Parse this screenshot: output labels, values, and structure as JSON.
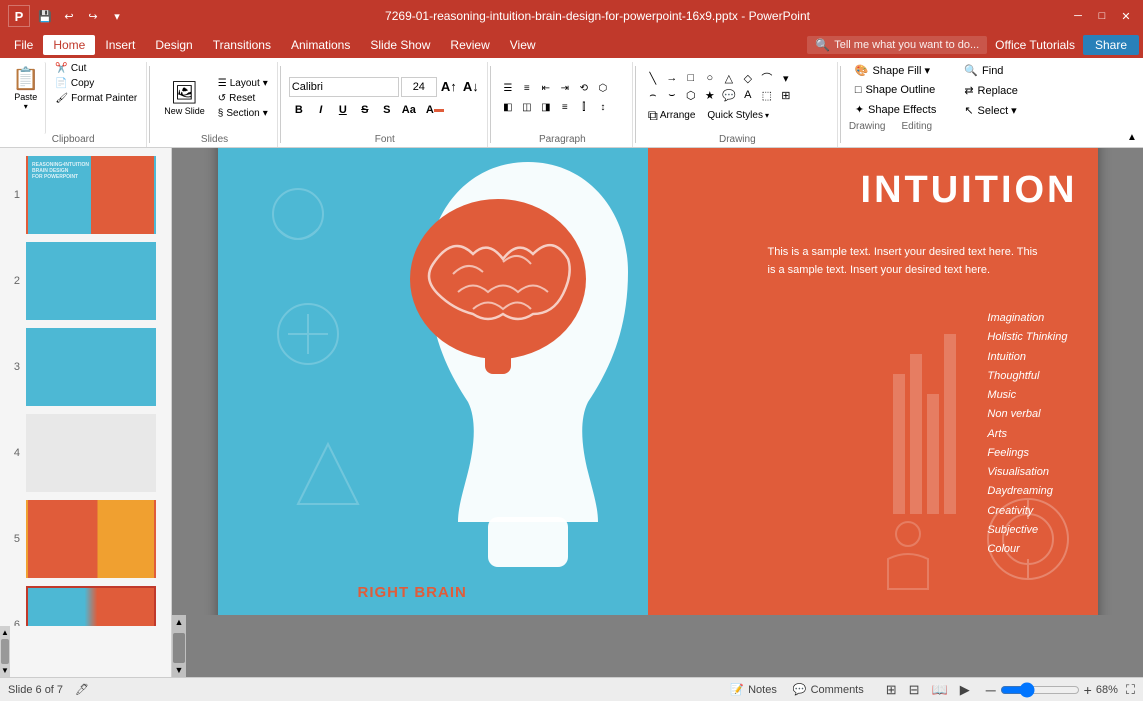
{
  "titlebar": {
    "title": "7269-01-reasoning-intuition-brain-design-for-powerpoint-16x9.pptx - PowerPoint",
    "save_icon": "💾",
    "undo_icon": "↩",
    "redo_icon": "↪",
    "customize_icon": "▾",
    "minimize": "─",
    "restore": "□",
    "close": "✕"
  },
  "menubar": {
    "items": [
      "File",
      "Home",
      "Insert",
      "Design",
      "Transitions",
      "Animations",
      "Slide Show",
      "Review",
      "View"
    ],
    "active": "Home",
    "help_placeholder": "Tell me what you want to do...",
    "office_tutorials": "Office Tutorials",
    "share": "Share"
  },
  "ribbon": {
    "clipboard_group": "Clipboard",
    "slides_group": "Slides",
    "font_group": "Font",
    "paragraph_group": "Paragraph",
    "drawing_group": "Drawing",
    "editing_group": "Editing",
    "paste_label": "Paste",
    "cut_label": "Cut",
    "copy_label": "Copy",
    "format_painter": "Format Painter",
    "new_slide": "New Slide",
    "layout": "Layout",
    "reset": "Reset",
    "section": "Section",
    "font_name": "Calibri",
    "font_size": "24",
    "bold": "B",
    "italic": "I",
    "underline": "U",
    "strikethrough": "S",
    "arrange_label": "Arrange",
    "quick_styles": "Quick Styles",
    "shape_fill": "Shape Fill ▾",
    "shape_outline": "Shape Outline",
    "shape_effects": "Shape Effects",
    "find": "Find",
    "replace": "Replace",
    "select": "Select ▾"
  },
  "slides": [
    {
      "num": "1",
      "active": false
    },
    {
      "num": "2",
      "active": false
    },
    {
      "num": "3",
      "active": false
    },
    {
      "num": "4",
      "active": false
    },
    {
      "num": "5",
      "active": false
    },
    {
      "num": "6",
      "active": true
    }
  ],
  "slide": {
    "title": "INTUITION",
    "desc_line1": "This is a sample text. Insert your desired text  here. This",
    "desc_line2": "is a sample text. Insert your desired text here.",
    "list_items": [
      "Imagination",
      "Holistic Thinking",
      "Intuition",
      "Thoughtful",
      "Music",
      "Non verbal",
      "Arts",
      "Feelings",
      "Visualisation",
      "Daydreaming",
      "Creativity",
      "Subjective",
      "Colour"
    ],
    "right_brain_label": "RIGHT BRAIN"
  },
  "statusbar": {
    "slide_info": "Slide 6 of 7",
    "notes": "Notes",
    "comments": "Comments",
    "zoom": "68%"
  }
}
